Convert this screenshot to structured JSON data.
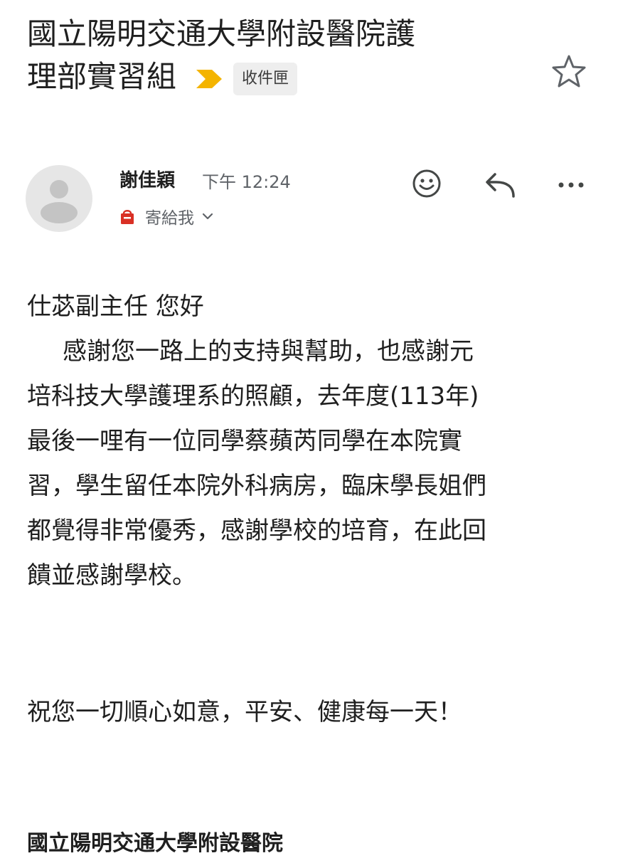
{
  "email": {
    "subject_line1": "國立陽明交通大學附設醫院護",
    "subject_line2": "理部實習組",
    "label_chip": "收件匣",
    "sender_name": "謝佳穎",
    "sent_time": "下午 12:24",
    "recipient_label": "寄給我",
    "body": {
      "greeting": "仕苾副主任 您好",
      "lines": [
        "感謝您一路上的支持與幫助，也感謝元",
        "培科技大學護理系的照顧，去年度(113年)",
        "最後一哩有一位同學蔡蘋芮同學在本院實",
        "習，學生留任本院外科病房，臨床學長姐們",
        "都覺得非常優秀，感謝學校的培育，在此回",
        "饋並感謝學校。"
      ],
      "closing": "祝您一切順心如意，平安、健康每一天！",
      "signature": "國立陽明交通大學附設醫院"
    }
  },
  "icons": {
    "importance": "importance-marker-icon",
    "star": "star-icon",
    "avatar": "person-avatar-icon",
    "tag": "shopping-bag-tag-icon",
    "chevron": "chevron-down-icon",
    "emoji": "smiley-face-icon",
    "reply": "reply-arrow-icon",
    "more": "more-horizontal-icon"
  },
  "colors": {
    "importance_marker": "#f4b400",
    "tag_icon": "#d93025",
    "chip_background": "#eeeeee",
    "secondary_text": "#5f6368"
  }
}
